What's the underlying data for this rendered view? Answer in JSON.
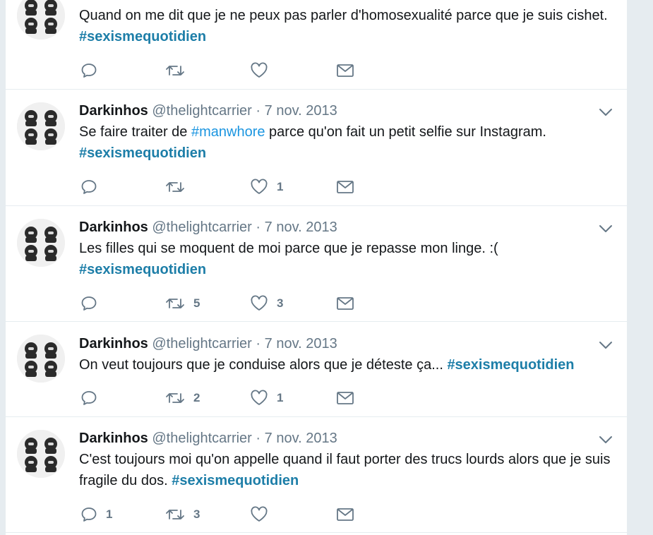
{
  "colors": {
    "hashtag": "#1b95e0",
    "hashtag_bold": "#1d7ea8",
    "muted": "#657786",
    "text": "#14171a",
    "background": "#e6ecf0"
  },
  "tweets": [
    {
      "name": "",
      "handle": "",
      "date": "",
      "text_before": "Quand on me dit que je ne peux pas parler d'homosexualité parce que je suis cishet. ",
      "hashtag_inline": "",
      "text_middle": "",
      "hashtag": "#sexismequotidien",
      "counts": {
        "reply": "",
        "retweet": "",
        "like": ""
      }
    },
    {
      "name": "Darkinhos",
      "handle": "@thelightcarrier",
      "sep": "·",
      "date": "7 nov. 2013",
      "text_before": "Se faire traiter de ",
      "hashtag_inline": "#manwhore",
      "text_middle": " parce qu'on fait un petit selfie sur Instagram.",
      "hashtag": "#sexismequotidien",
      "counts": {
        "reply": "",
        "retweet": "",
        "like": "1"
      }
    },
    {
      "name": "Darkinhos",
      "handle": "@thelightcarrier",
      "sep": "·",
      "date": "7 nov. 2013",
      "text_before": "Les filles qui se moquent de moi parce que je repasse mon linge. :(",
      "hashtag": "#sexismequotidien",
      "counts": {
        "reply": "",
        "retweet": "5",
        "like": "3"
      }
    },
    {
      "name": "Darkinhos",
      "handle": "@thelightcarrier",
      "sep": "·",
      "date": "7 nov. 2013",
      "text_before": "On veut toujours que je conduise alors que je déteste ça... ",
      "hashtag": "#sexismequotidien",
      "counts": {
        "reply": "",
        "retweet": "2",
        "like": "1"
      }
    },
    {
      "name": "Darkinhos",
      "handle": "@thelightcarrier",
      "sep": "·",
      "date": "7 nov. 2013",
      "text_before": "C'est toujours moi qu'on appelle quand il faut porter des trucs lourds alors que je suis fragile du dos. ",
      "hashtag": "#sexismequotidien",
      "counts": {
        "reply": "1",
        "retweet": "3",
        "like": ""
      }
    }
  ],
  "icons": {
    "reply": "reply-icon",
    "retweet": "retweet-icon",
    "like": "heart-icon",
    "dm": "envelope-icon",
    "caret": "chevron-down-icon",
    "avatar": "avatar-portrait-grid"
  }
}
